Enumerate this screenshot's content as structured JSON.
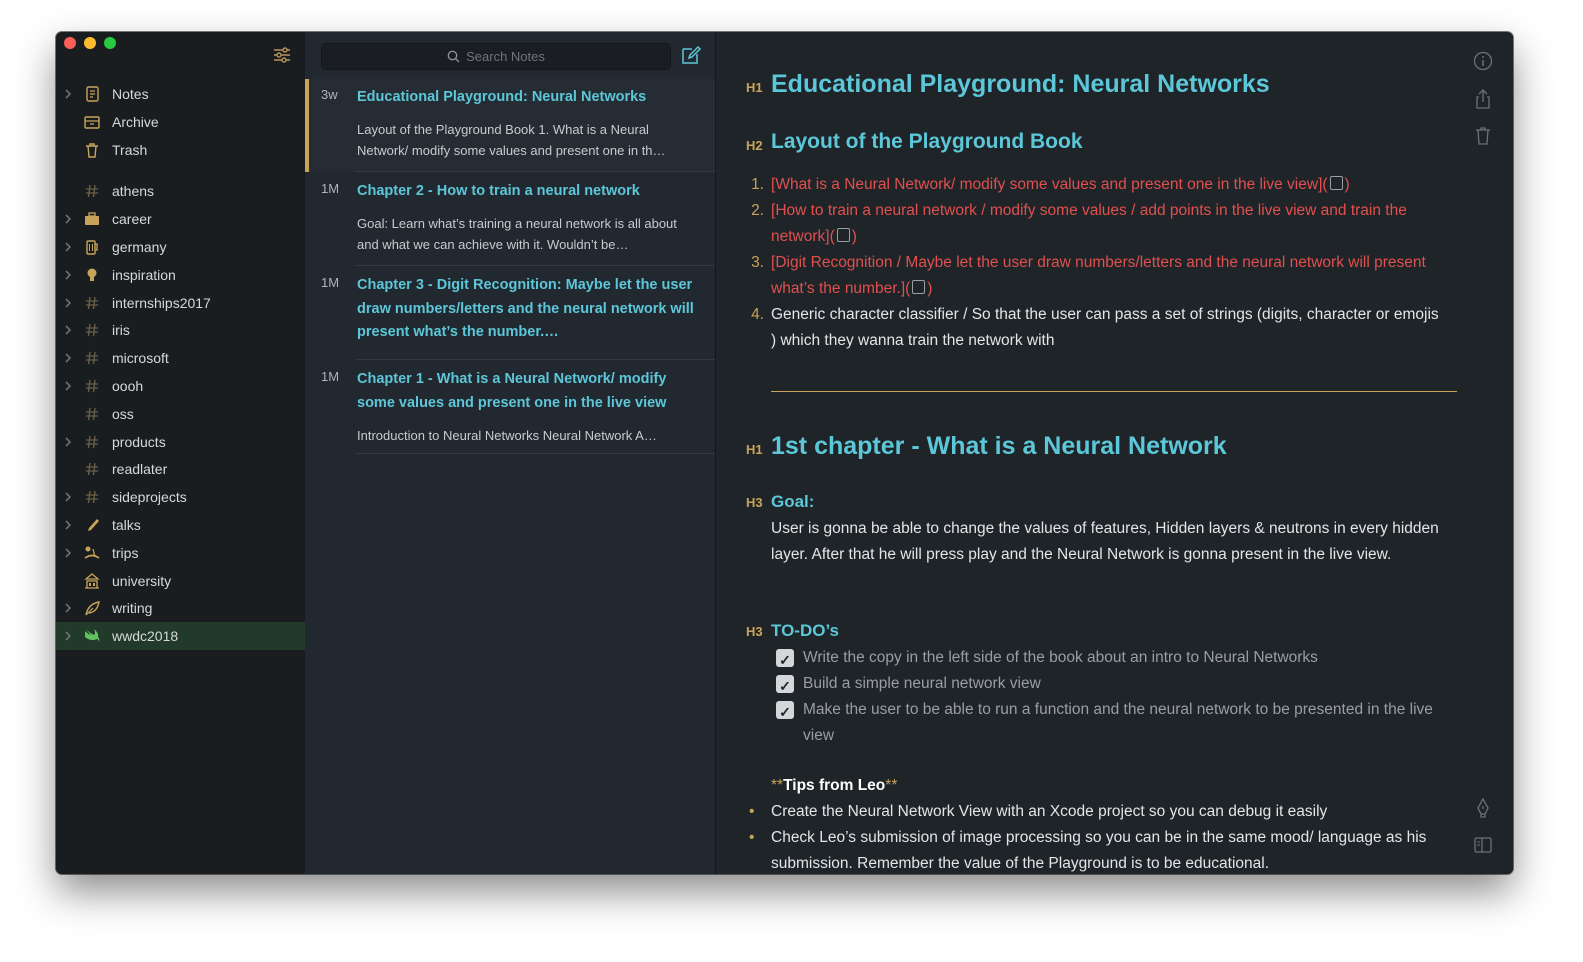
{
  "sidebar": {
    "items": [
      {
        "label": "Notes",
        "icon": "notes-icon",
        "chevron": true
      },
      {
        "label": "Archive",
        "icon": "archive-icon",
        "chevron": false
      },
      {
        "label": "Trash",
        "icon": "trash-icon",
        "chevron": false
      },
      {
        "label": "athens",
        "icon": "hash-icon",
        "chevron": false
      },
      {
        "label": "career",
        "icon": "briefcase-icon",
        "chevron": true
      },
      {
        "label": "germany",
        "icon": "beer-icon",
        "chevron": true
      },
      {
        "label": "inspiration",
        "icon": "lightbulb-icon",
        "chevron": true
      },
      {
        "label": "internships2017",
        "icon": "hash-icon",
        "chevron": true
      },
      {
        "label": "iris",
        "icon": "hash-icon",
        "chevron": true
      },
      {
        "label": "microsoft",
        "icon": "hash-icon",
        "chevron": true
      },
      {
        "label": "oooh",
        "icon": "hash-icon",
        "chevron": true
      },
      {
        "label": "oss",
        "icon": "hash-icon",
        "chevron": false
      },
      {
        "label": "products",
        "icon": "hash-icon",
        "chevron": true
      },
      {
        "label": "readlater",
        "icon": "hash-icon",
        "chevron": false
      },
      {
        "label": "sideprojects",
        "icon": "hash-icon",
        "chevron": true
      },
      {
        "label": "talks",
        "icon": "microphone-icon",
        "chevron": true
      },
      {
        "label": "trips",
        "icon": "beach-icon",
        "chevron": true
      },
      {
        "label": "university",
        "icon": "building-icon",
        "chevron": false
      },
      {
        "label": "writing",
        "icon": "feather-icon",
        "chevron": true
      },
      {
        "label": "wwdc2018",
        "icon": "swift-icon",
        "chevron": true
      }
    ]
  },
  "search": {
    "placeholder": "Search Notes"
  },
  "notes": [
    {
      "age": "3w",
      "title": "Educational Playground: Neural Networks",
      "preview": "Layout of the Playground Book 1. What is a Neural Network/ modify some values and present one in th…"
    },
    {
      "age": "1M",
      "title": "Chapter 2 - How to train a neural network",
      "preview": "Goal: Learn what’s training a neural network is all about and what we can achieve with it. Wouldn’t be…"
    },
    {
      "age": "1M",
      "title": "Chapter 3 -  Digit Recognition: Maybe let the user draw numbers/letters and the neural network will present what’s the number.…",
      "preview": ""
    },
    {
      "age": "1M",
      "title": "Chapter 1 -  What is a Neural Network/ modify some values and present one in the live view",
      "preview": "Introduction to Neural Networks Neural Network A…"
    }
  ],
  "editor": {
    "h1_mark": "H1",
    "title": "Educational Playground: Neural Networks",
    "h2_mark": "H2",
    "subtitle": "Layout of the Playground Book",
    "ordered": [
      {
        "num": "1.",
        "text": "What is a Neural Network/ modify some values and present one in the live view"
      },
      {
        "num": "2.",
        "text": "How to train a neural network / modify some values / add points in the live view and train the network"
      },
      {
        "num": "3.",
        "text": "Digit Recognition / Maybe let the user draw numbers/letters and the neural network will present what’s the number."
      },
      {
        "num": "4.",
        "text": "Generic character classifier / So that the user can pass a set of strings (digits, character or emojis ) which they wanna train the network with"
      }
    ],
    "h1b_mark": "H1",
    "chapter_title": "1st chapter - What is a Neural Network",
    "h3_mark": "H3",
    "goal_heading": "Goal:",
    "goal_text": "User is gonna be able to change the values of features, Hidden layers & neutrons in every hidden layer. After that he will press play and the Neural Network is gonna present in the live view.",
    "h3b_mark": "H3",
    "todo_heading": "TO-DO’s",
    "todos": [
      "Write the copy in the left side of the book about an intro to Neural Networks",
      "Build a simple neural network view",
      "Make the user to be able to run a function and the neural network to be presented in the live view"
    ],
    "tips_heading": "Tips from Leo",
    "tips": [
      "Create the Neural Network View with an Xcode project so you can debug it easily",
      "Check Leo’s submission of image processing so you can be in the same mood/ language as his submission. Remember the value of the Playground is to be educational."
    ]
  },
  "colors": {
    "accent_gold": "#c8a45a",
    "heading_cyan": "#5cc7d8",
    "link_red": "#e0504f",
    "selected_green": "#223a2a"
  }
}
